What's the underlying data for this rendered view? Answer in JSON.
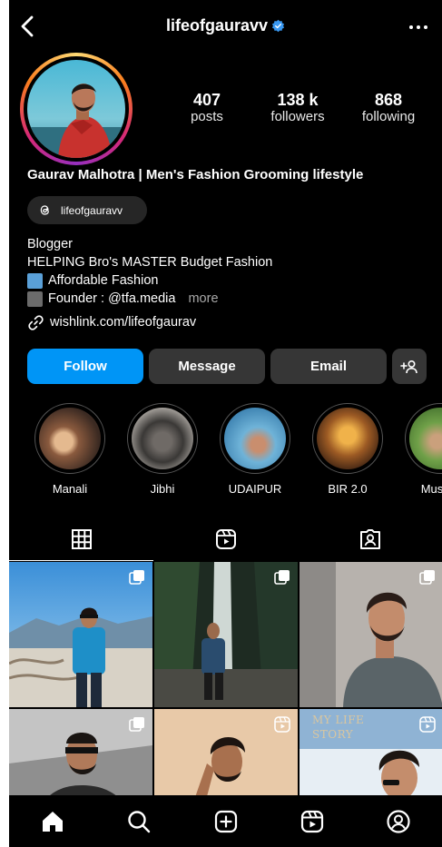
{
  "header": {
    "username": "lifeofgauravv"
  },
  "stats": [
    {
      "value": "407",
      "label": "posts"
    },
    {
      "value": "138 k",
      "label": "followers"
    },
    {
      "value": "868",
      "label": "following"
    }
  ],
  "profile": {
    "full_name": "Gaurav Malhotra | Men's Fashion Grooming lifestyle",
    "threads_handle": "lifeofgauravv",
    "bio_lines": [
      "Blogger",
      "HELPING Bro's MASTER Budget Fashion",
      "Affordable Fashion",
      "Founder : @tfa.media"
    ],
    "more_label": "more",
    "link": "wishlink.com/lifeofgaurav"
  },
  "actions": {
    "follow": "Follow",
    "message": "Message",
    "email": "Email"
  },
  "highlights": [
    "Manali",
    "Jibhi",
    "UDAIPUR",
    "BIR 2.0",
    "Mussor"
  ],
  "grid_story_text": "MY LIFE\nSTORY",
  "colors": {
    "accent": "#0095f6",
    "background": "#000000",
    "button": "#363636",
    "verified": "#3897f0"
  },
  "icons": {
    "header": [
      "back-arrow-icon",
      "verified-badge-icon",
      "more-options-icon"
    ],
    "tabs": [
      "grid-icon",
      "reels-icon",
      "tagged-icon"
    ],
    "nav": [
      "home-icon",
      "search-icon",
      "create-icon",
      "reels-icon",
      "profile-icon"
    ]
  }
}
